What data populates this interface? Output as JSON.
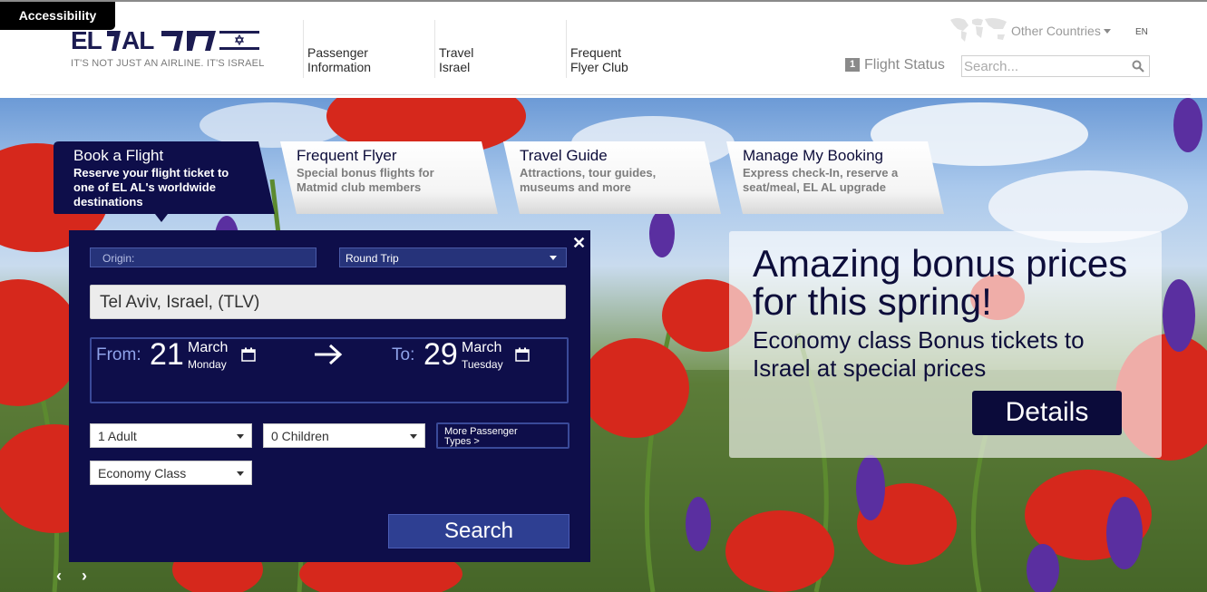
{
  "accessibility": {
    "label": "Accessibility"
  },
  "brand": {
    "logo_text": "EL AL",
    "tagline": "IT'S NOT JUST AN AIRLINE. IT'S ISRAEL"
  },
  "nav": {
    "items": [
      {
        "line1": "Passenger",
        "line2": "Information"
      },
      {
        "line1": "Travel",
        "line2": "Israel"
      },
      {
        "line1": "Frequent",
        "line2": "Flyer Club"
      }
    ]
  },
  "header": {
    "other_countries": "Other Countries",
    "lang": "EN",
    "flight_status_num": "1",
    "flight_status": "Flight Status",
    "search_placeholder": "Search..."
  },
  "tabs": [
    {
      "title": "Book a Flight",
      "desc1": "Reserve your flight ticket to",
      "desc2": "one of EL AL's worldwide",
      "desc3": "destinations",
      "active": true
    },
    {
      "title": "Frequent Flyer",
      "desc1": "Special bonus flights for",
      "desc2": "Matmid club members",
      "desc3": "",
      "active": false
    },
    {
      "title": "Travel Guide",
      "desc1": "Attractions, tour guides,",
      "desc2": "museums and more",
      "desc3": "",
      "active": false
    },
    {
      "title": "Manage My Booking",
      "desc1": "Express check-In, reserve a",
      "desc2": "seat/meal, EL AL upgrade",
      "desc3": "",
      "active": false
    }
  ],
  "booking": {
    "close": "✕",
    "origin_label": "Origin:",
    "trip_type": "Round Trip",
    "origin_value": "Tel Aviv, Israel, (TLV)",
    "from_label": "From:",
    "from_day": "21",
    "from_month": "March",
    "from_weekday": "Monday",
    "to_label": "To:",
    "to_day": "29",
    "to_month": "March",
    "to_weekday": "Tuesday",
    "adults": "1 Adult",
    "children": "0 Children",
    "more_pax_line1": "More Passenger",
    "more_pax_line2": "Types >",
    "cabin": "Economy Class",
    "search": "Search",
    "prev": "‹",
    "next": "›"
  },
  "promo": {
    "headline1": "Amazing bonus prices",
    "headline2": "for this spring!",
    "sub1": "Economy class Bonus tickets to",
    "sub2": "Israel at special prices",
    "details": "Details"
  },
  "colors": {
    "navy": "#0e0e4a",
    "accent": "#2e3f92",
    "poppy": "#d6281c"
  }
}
